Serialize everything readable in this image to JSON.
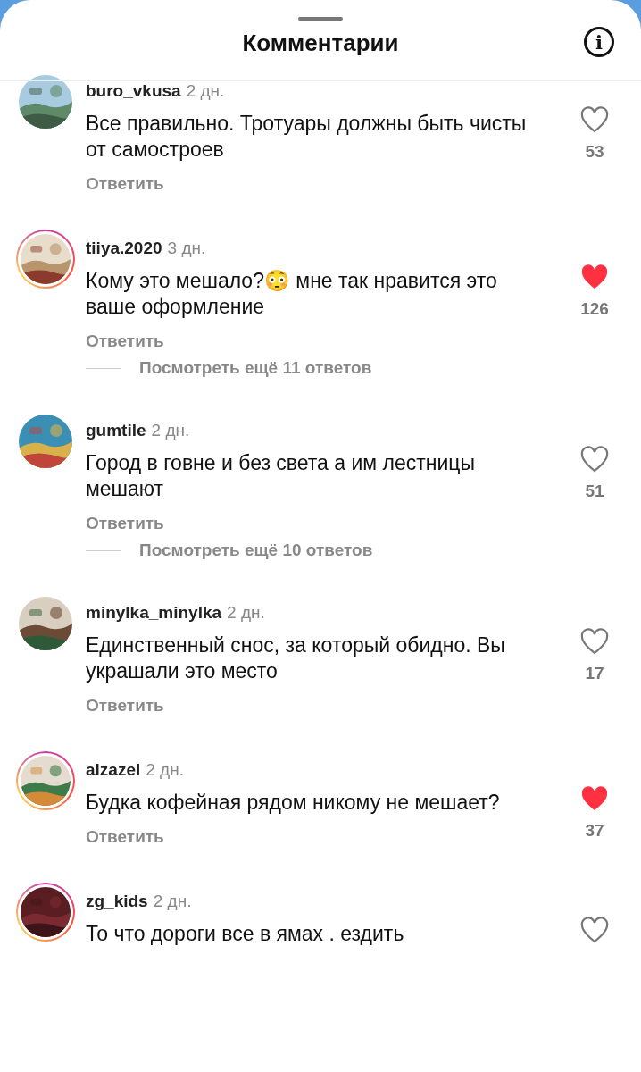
{
  "header": {
    "title": "Комментарии",
    "info_label": "i"
  },
  "comments": [
    {
      "author": "buro_vkusa",
      "time": "2 дн.",
      "text": "Все правильно. Тротуары должны быть чисты от самостроев",
      "reply": "Ответить",
      "liked": false,
      "likes": "53",
      "story_ring": false
    },
    {
      "author": "tiiya.2020",
      "time": "3 дн.",
      "text": "Кому это мешало?😳 мне так нравится это ваше оформление",
      "reply": "Ответить",
      "liked": true,
      "likes": "126",
      "story_ring": true,
      "more_replies": "Посмотреть ещё 11 ответов"
    },
    {
      "author": "gumtile",
      "time": "2 дн.",
      "text": "Город в говне и без света  а им лестницы мешают",
      "reply": "Ответить",
      "liked": false,
      "likes": "51",
      "story_ring": false,
      "more_replies": "Посмотреть ещё 10 ответов"
    },
    {
      "author": "minylka_minylka",
      "time": "2 дн.",
      "text": "Единственный снос, за который обидно. Вы украшали это место",
      "reply": "Ответить",
      "liked": false,
      "likes": "17",
      "story_ring": false
    },
    {
      "author": "aizazel",
      "time": "2 дн.",
      "text": "Будка кофейная рядом никому не мешает?",
      "reply": "Ответить",
      "liked": true,
      "likes": "37",
      "story_ring": true
    },
    {
      "author": "zg_kids",
      "time": "2 дн.",
      "text": "То что дороги все в ямах . ездить",
      "liked": false,
      "story_ring": true
    }
  ]
}
